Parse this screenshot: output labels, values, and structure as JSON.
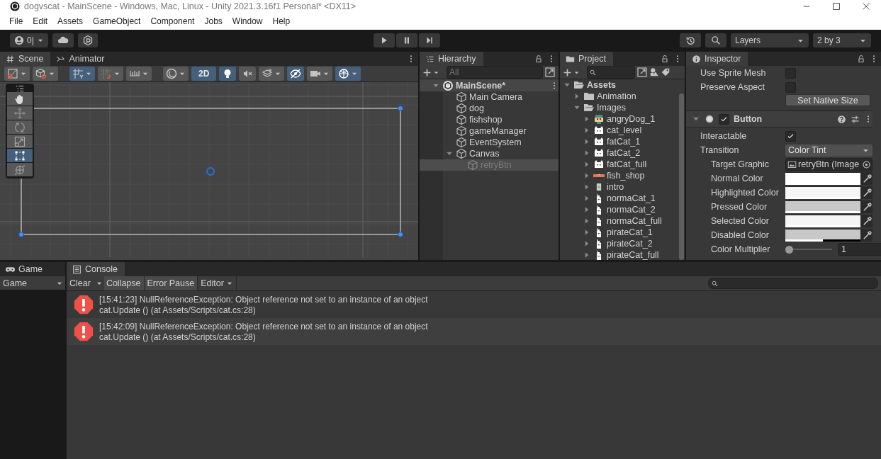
{
  "window": {
    "title": "dogvscat - MainScene - Windows, Mac, Linux - Unity 2021.3.16f1 Personal* <DX11>"
  },
  "menu": [
    "File",
    "Edit",
    "Assets",
    "GameObject",
    "Component",
    "Jobs",
    "Window",
    "Help"
  ],
  "toolbar": {
    "account": "0|",
    "layers": "Layers",
    "layout": "2 by 3"
  },
  "scene": {
    "tabs": [
      {
        "label": "Scene",
        "kind": "scene",
        "selected": true
      },
      {
        "label": "Animator",
        "kind": "animator",
        "selected": false
      }
    ],
    "toolbar": [
      {
        "kind": "draw-mode",
        "on": false,
        "caret": true
      },
      {
        "kind": "shading",
        "on": false,
        "caret": true
      },
      {
        "kind": "grid-snap",
        "on": true,
        "caret": true
      },
      {
        "kind": "increment-snap",
        "on": false,
        "caret": true
      },
      {
        "kind": "ruler",
        "on": false,
        "caret": true
      },
      {
        "kind": "orbit",
        "on": false,
        "caret": true
      },
      {
        "kind": "text",
        "label": "2D",
        "on": true,
        "caret": false
      },
      {
        "kind": "light",
        "on": true,
        "caret": false
      },
      {
        "kind": "audio",
        "on": false,
        "caret": false
      },
      {
        "kind": "effects",
        "on": false,
        "caret": true
      },
      {
        "kind": "visibility",
        "on": true,
        "caret": false
      },
      {
        "kind": "camera",
        "on": false,
        "caret": true
      },
      {
        "kind": "gizmos",
        "on": true,
        "caret": true
      }
    ],
    "tools": [
      {
        "kind": "hand",
        "selected": false
      },
      {
        "kind": "move",
        "selected": false
      },
      {
        "kind": "rotate",
        "selected": false
      },
      {
        "kind": "scale",
        "selected": false
      },
      {
        "kind": "rect",
        "selected": true
      },
      {
        "kind": "transform",
        "selected": false
      }
    ]
  },
  "hierarchy": {
    "tabs": [
      {
        "label": "Hierarchy",
        "selected": true
      }
    ],
    "placeholder": "All",
    "tree": {
      "label": "MainScene*",
      "expanded": true,
      "children": [
        {
          "label": "Main Camera",
          "selected": false,
          "inactive": false
        },
        {
          "label": "dog",
          "selected": false,
          "inactive": false
        },
        {
          "label": "fishshop",
          "selected": false,
          "inactive": false
        },
        {
          "label": "gameManager",
          "selected": false,
          "inactive": false
        },
        {
          "label": "EventSystem",
          "selected": false,
          "inactive": false
        },
        {
          "label": "Canvas",
          "selected": false,
          "inactive": false,
          "expanded": true,
          "children": [
            {
              "label": "retryBtn",
              "selected": true,
              "inactive": true
            }
          ]
        }
      ]
    }
  },
  "project": {
    "tabs": [
      {
        "label": "Project",
        "selected": true
      }
    ],
    "tree": {
      "label": "Assets",
      "expanded": true,
      "children": [
        {
          "label": "Animation",
          "kind": "folder",
          "expanded": false
        },
        {
          "label": "Images",
          "kind": "folder",
          "expanded": true,
          "children": [
            {
              "label": "angryDog_1",
              "kind": "dog"
            },
            {
              "label": "cat_level",
              "kind": "cat"
            },
            {
              "label": "fatCat_1",
              "kind": "cat"
            },
            {
              "label": "fatCat_2",
              "kind": "cat"
            },
            {
              "label": "fatCat_full",
              "kind": "cat"
            },
            {
              "label": "fish_shop",
              "kind": "bar"
            },
            {
              "label": "intro",
              "kind": "card"
            },
            {
              "label": "normaCat_1",
              "kind": "tall"
            },
            {
              "label": "normaCat_2",
              "kind": "tall"
            },
            {
              "label": "normaCat_full",
              "kind": "tall"
            },
            {
              "label": "pirateCat_1",
              "kind": "tall"
            },
            {
              "label": "pirateCat_2",
              "kind": "tall"
            },
            {
              "label": "pirateCat_full",
              "kind": "tall"
            }
          ]
        }
      ]
    }
  },
  "inspector": {
    "tabs": [
      {
        "label": "Inspector",
        "selected": true
      }
    ],
    "image_fields": [
      {
        "label": "Use Sprite Mesh",
        "checked": false
      },
      {
        "label": "Preserve Aspect",
        "checked": false
      }
    ],
    "native_size_button": "Set Native Size",
    "component": {
      "name": "Button",
      "enabled": true,
      "expanded": true
    },
    "fields": [
      {
        "kind": "checkbox",
        "label": "Interactable",
        "checked": true
      },
      {
        "kind": "dropdown",
        "label": "Transition",
        "value": "Color Tint"
      },
      {
        "kind": "object",
        "label": "Target Graphic",
        "value": "retryBtn (Image"
      },
      {
        "kind": "color",
        "label": "Normal Color",
        "color": "#ffffff",
        "level": 1
      },
      {
        "kind": "color",
        "label": "Highlighted Color",
        "color": "#f5f5f5",
        "level": 1
      },
      {
        "kind": "color",
        "label": "Pressed Color",
        "color": "#c8c8c8",
        "level": 1
      },
      {
        "kind": "color",
        "label": "Selected Color",
        "color": "#f5f5f5",
        "level": 1
      },
      {
        "kind": "color",
        "label": "Disabled Color",
        "color": "#c8c8c8",
        "level": 0.5
      },
      {
        "kind": "slider",
        "label": "Color Multiplier",
        "level": 0,
        "value": "1"
      }
    ]
  },
  "game": {
    "tabs": [
      {
        "label": "Game",
        "selected": false
      }
    ],
    "display": "Game"
  },
  "console": {
    "tabs": [
      {
        "label": "Console",
        "selected": true
      }
    ],
    "buttons": [
      {
        "label": "Clear",
        "kind": "split"
      },
      {
        "label": "Collapse",
        "kind": "toggle"
      },
      {
        "label": "Error Pause",
        "kind": "toggle"
      },
      {
        "label": "Editor",
        "kind": "dropdown"
      }
    ],
    "messages": [
      {
        "line1": "[15:41:23] NullReferenceException: Object reference not set to an instance of an object",
        "line2": "cat.Update () (at Assets/Scripts/cat.cs:28)"
      },
      {
        "line1": "[15:42:09] NullReferenceException: Object reference not set to an instance of an object",
        "line2": "cat.Update () (at Assets/Scripts/cat.cs:28)"
      }
    ]
  }
}
